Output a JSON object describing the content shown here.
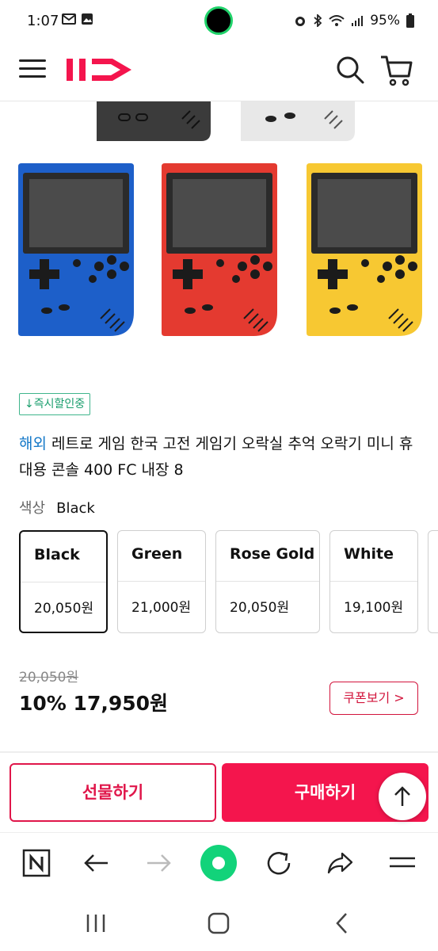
{
  "status_bar": {
    "time": "1:07",
    "notif_icons": [
      "gmail-icon",
      "gallery-icon"
    ],
    "right_icons": [
      "alarm-icon",
      "bluetooth-icon",
      "wifi-icon",
      "signal-icon"
    ],
    "battery": "95%"
  },
  "header": {
    "logo_text": "11",
    "icons": [
      "menu-icon",
      "search-icon",
      "cart-icon"
    ]
  },
  "product": {
    "images": [
      {
        "color": "#3b3b3b"
      },
      {
        "color": "#e8e8e8"
      },
      {
        "color": "#1d5fc9"
      },
      {
        "color": "#e43a30"
      },
      {
        "color": "#f7c832"
      }
    ],
    "cert_badge": "↓즉시할인중",
    "overseas_label": "해외",
    "title": " 레트로 게임 한국 고전 게임기 오락실 추억 오락기 미니 휴대용 콘솔 400 FC 내장 8",
    "option_key": "색상",
    "option_value": "Black",
    "options": [
      {
        "name": "Black",
        "price": "20,050원",
        "selected": true
      },
      {
        "name": "Green",
        "price": "21,000원",
        "selected": false
      },
      {
        "name": "Rose Gold",
        "price": "20,050원",
        "selected": false
      },
      {
        "name": "White",
        "price": "19,100원",
        "selected": false
      }
    ],
    "original_price": "20,050원",
    "sale_price": "10% 17,950원",
    "coupon_label": "쿠폰보기 >"
  },
  "actions": {
    "gift_label": "선물하기",
    "buy_label": "구매하기"
  },
  "colors": {
    "brand": "#f4154d",
    "gift_border": "#e0164a",
    "badge_green": "#1a9e6d",
    "overseas_blue": "#1478c8"
  },
  "browser_bar": {
    "icons": [
      "naver-icon",
      "back-arrow-icon",
      "forward-arrow-icon",
      "home-circle-icon",
      "refresh-icon",
      "share-icon",
      "menu-icon"
    ]
  },
  "system_nav": {
    "icons": [
      "recent-apps-icon",
      "home-icon",
      "back-icon"
    ]
  }
}
